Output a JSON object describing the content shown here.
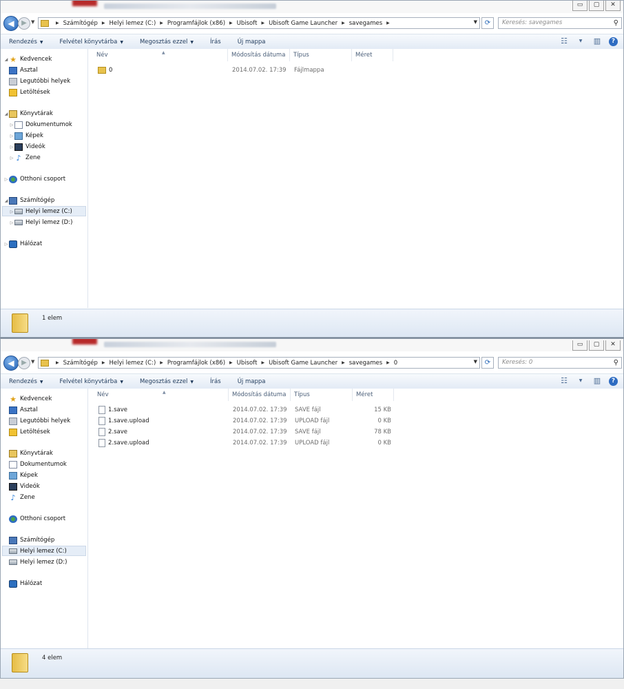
{
  "windows": [
    {
      "id": "w1",
      "window_buttons": {
        "minimize": "▭",
        "maximize": "▢",
        "close": "✕"
      },
      "breadcrumb": [
        "Számítógép",
        "Helyi lemez (C:)",
        "Programfájlok (x86)",
        "Ubisoft",
        "Ubisoft Game Launcher",
        "savegames"
      ],
      "search_placeholder": "Keresés: savegames",
      "toolbar": {
        "organize": "Rendezés",
        "include_library": "Felvétel könyvtárba",
        "share": "Megosztás ezzel",
        "burn": "Írás",
        "new_folder": "Új mappa"
      },
      "nav": {
        "favorites": "Kedvencek",
        "desktop": "Asztal",
        "recent": "Legutóbbi helyek",
        "downloads": "Letöltések",
        "libraries": "Könyvtárak",
        "documents": "Dokumentumok",
        "pictures": "Képek",
        "videos": "Videók",
        "music": "Zene",
        "homegroup": "Otthoni csoport",
        "computer": "Számítógép",
        "drive_c": "Helyi lemez (C:)",
        "drive_d": "Helyi lemez (D:)",
        "network": "Hálózat"
      },
      "columns": {
        "name": "Név",
        "modified": "Módosítás dátuma",
        "type": "Típus",
        "size": "Méret"
      },
      "rows": [
        {
          "name": "0",
          "modified": "2014.07.02. 17:39",
          "type": "Fájlmappa",
          "size": ""
        }
      ],
      "status_count": "1 elem"
    },
    {
      "id": "w2",
      "window_buttons": {
        "minimize": "▭",
        "maximize": "▢",
        "close": "✕"
      },
      "breadcrumb": [
        "Számítógép",
        "Helyi lemez (C:)",
        "Programfájlok (x86)",
        "Ubisoft",
        "Ubisoft Game Launcher",
        "savegames",
        "0"
      ],
      "search_placeholder": "Keresés: 0",
      "toolbar": {
        "organize": "Rendezés",
        "include_library": "Felvétel könyvtárba",
        "share": "Megosztás ezzel",
        "burn": "Írás",
        "new_folder": "Új mappa"
      },
      "nav": {
        "favorites": "Kedvencek",
        "desktop": "Asztal",
        "recent": "Legutóbbi helyek",
        "downloads": "Letöltések",
        "libraries": "Könyvtárak",
        "documents": "Dokumentumok",
        "pictures": "Képek",
        "videos": "Videók",
        "music": "Zene",
        "homegroup": "Otthoni csoport",
        "computer": "Számítógép",
        "drive_c": "Helyi lemez (C:)",
        "drive_d": "Helyi lemez (D:)",
        "network": "Hálózat"
      },
      "columns": {
        "name": "Név",
        "modified": "Módosítás dátuma",
        "type": "Típus",
        "size": "Méret"
      },
      "rows": [
        {
          "name": "1.save",
          "modified": "2014.07.02. 17:39",
          "type": "SAVE fájl",
          "size": "15 KB"
        },
        {
          "name": "1.save.upload",
          "modified": "2014.07.02. 17:39",
          "type": "UPLOAD fájl",
          "size": "0 KB"
        },
        {
          "name": "2.save",
          "modified": "2014.07.02. 17:39",
          "type": "SAVE fájl",
          "size": "78 KB"
        },
        {
          "name": "2.save.upload",
          "modified": "2014.07.02. 17:39",
          "type": "UPLOAD fájl",
          "size": "0 KB"
        }
      ],
      "status_count": "4 elem"
    }
  ]
}
